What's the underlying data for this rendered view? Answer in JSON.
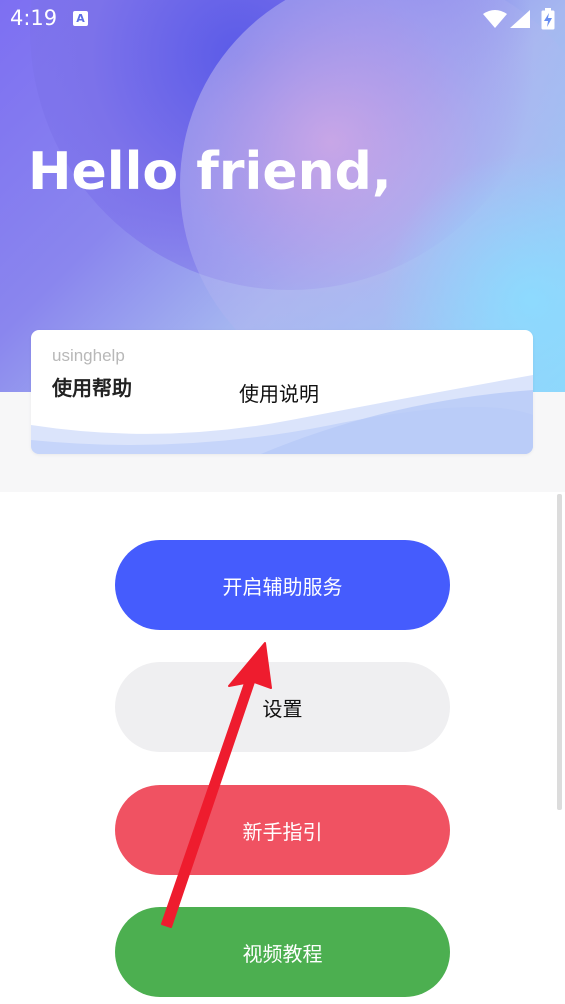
{
  "status_bar": {
    "time": "4:19",
    "notification_glyph": "A",
    "icons": [
      "wifi-icon",
      "signal-icon",
      "battery-charging-icon"
    ]
  },
  "hero": {
    "greeting": "Hello friend,"
  },
  "help_card": {
    "subtitle_en": "usinghelp",
    "title_cn": "使用帮助",
    "link_label": "使用说明"
  },
  "buttons": {
    "accessibility": "开启辅助服务",
    "settings": "设置",
    "guide": "新手指引",
    "video": "视频教程"
  },
  "colors": {
    "accessibility_button": "#455cfd",
    "settings_button": "#efeff1",
    "guide_button": "#f05262",
    "video_button": "#4caf50",
    "annotation_arrow": "#ee1c2e"
  }
}
